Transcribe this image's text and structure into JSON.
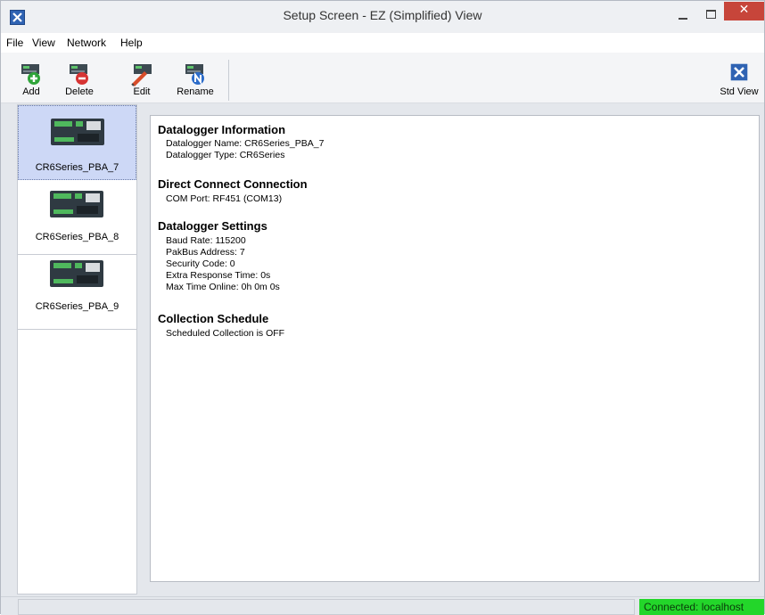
{
  "window": {
    "title": "Setup Screen - EZ (Simplified) View"
  },
  "menu": {
    "items": [
      "File",
      "View",
      "Network",
      "Help"
    ]
  },
  "toolbar": {
    "add_label": "Add",
    "delete_label": "Delete",
    "edit_label": "Edit",
    "rename_label": "Rename",
    "std_view_label": "Std View"
  },
  "loggers": [
    {
      "name": "CR6Series_PBA_7",
      "selected": true
    },
    {
      "name": "CR6Series_PBA_8",
      "selected": false
    },
    {
      "name": "CR6Series_PBA_9",
      "selected": false
    }
  ],
  "details": {
    "info_title": "Datalogger Information",
    "info_lines": [
      "Datalogger Name: CR6Series_PBA_7",
      "Datalogger Type: CR6Series"
    ],
    "conn_title": "Direct Connect Connection",
    "conn_lines": [
      "COM Port: RF451 (COM13)"
    ],
    "settings_title": "Datalogger Settings",
    "settings_lines": [
      "Baud Rate: 115200",
      "PakBus Address: 7",
      "Security Code: 0",
      "Extra Response Time: 0s",
      "Max Time Online: 0h 0m 0s"
    ],
    "schedule_title": "Collection Schedule",
    "schedule_lines": [
      "Scheduled Collection is OFF"
    ]
  },
  "status": {
    "connected_text": "Connected: localhost"
  },
  "colors": {
    "close_button": "#c7453a",
    "selected_item": "#cdd8f6",
    "status_connected": "#23d62a"
  },
  "icons": {
    "add": "add-datalogger-icon",
    "delete": "delete-datalogger-icon",
    "edit": "edit-datalogger-icon",
    "rename": "rename-datalogger-icon",
    "std_view": "std-view-icon"
  }
}
